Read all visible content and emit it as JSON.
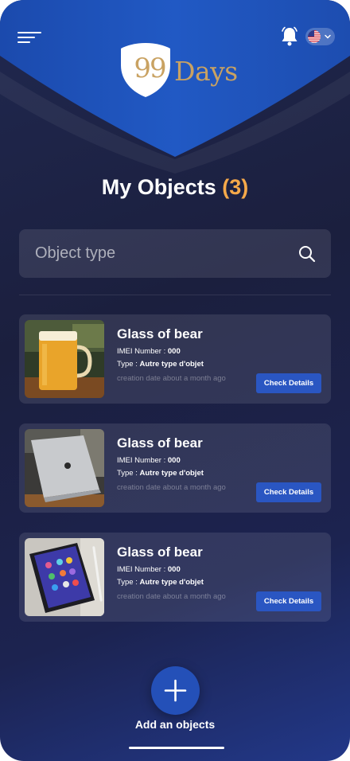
{
  "header": {
    "logo_number": "99",
    "logo_word": "Days",
    "language": "en-US"
  },
  "page": {
    "title": "My Objects",
    "count": "(3)"
  },
  "search": {
    "placeholder": "Object type"
  },
  "objects": [
    {
      "name": "Glass of bear",
      "imei_label": "IMEI Number : ",
      "imei_value": "000",
      "type_label": "Type : ",
      "type_value": "Autre type d'objet",
      "date": "creation date about a month ago",
      "button": "Check Details",
      "image": "beer-glass"
    },
    {
      "name": "Glass of bear",
      "imei_label": "IMEI Number : ",
      "imei_value": "000",
      "type_label": "Type : ",
      "type_value": "Autre type d'objet",
      "date": "creation date about a month ago",
      "button": "Check Details",
      "image": "laptop"
    },
    {
      "name": "Glass of bear",
      "imei_label": "IMEI Number : ",
      "imei_value": "000",
      "type_label": "Type : ",
      "type_value": "Autre type d'objet",
      "date": "creation date about a month ago",
      "button": "Check Details",
      "image": "tablet"
    }
  ],
  "footer": {
    "add_label": "Add an objects"
  },
  "colors": {
    "accent_count": "#f5a94a",
    "button_blue": "#2a56c2",
    "header_blue": "#1e4fb3",
    "logo_gold": "#c9a262"
  },
  "icons": [
    "hamburger-menu-icon",
    "bell-icon",
    "us-flag-icon",
    "chevron-down-icon",
    "search-icon",
    "plus-icon"
  ]
}
